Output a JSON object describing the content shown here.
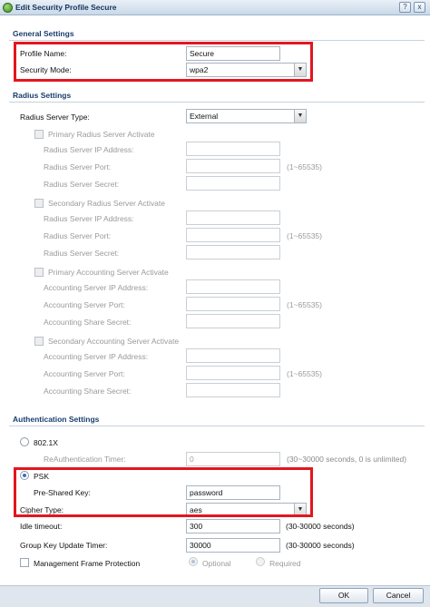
{
  "window": {
    "title": "Edit Security Profile Secure",
    "help_glyph": "?",
    "close_glyph": "x"
  },
  "general": {
    "section_title": "General Settings",
    "profile_name_label": "Profile Name:",
    "profile_name_value": "Secure",
    "security_mode_label": "Security Mode:",
    "security_mode_value": "wpa2"
  },
  "radius": {
    "section_title": "Radius Settings",
    "server_type_label": "Radius Server Type:",
    "server_type_value": "External",
    "groups": [
      {
        "check_label": "Primary Radius Server Activate",
        "ip_label": "Radius Server IP Address:",
        "port_label": "Radius Server Port:",
        "port_hint": "(1~65535)",
        "secret_label": "Radius Server Secret:"
      },
      {
        "check_label": "Secondary Radius Server Activate",
        "ip_label": "Radius Server IP Address:",
        "port_label": "Radius Server Port:",
        "port_hint": "(1~65535)",
        "secret_label": "Radius Server Secret:"
      },
      {
        "check_label": "Primary Accounting Server Activate",
        "ip_label": "Accounting Server IP Address:",
        "port_label": "Accounting Server Port:",
        "port_hint": "(1~65535)",
        "secret_label": "Accounting Share Secret:"
      },
      {
        "check_label": "Secondary Accounting Server Activate",
        "ip_label": "Accounting Server IP Address:",
        "port_label": "Accounting Server Port:",
        "port_hint": "(1~65535)",
        "secret_label": "Accounting Share Secret:"
      }
    ]
  },
  "auth": {
    "section_title": "Authentication Settings",
    "dot1x_label": "802.1X",
    "reauth_label": "ReAuthentication Timer:",
    "reauth_value": "0",
    "reauth_hint": "(30~30000 seconds, 0 is unlimited)",
    "psk_label": "PSK",
    "psk_key_label": "Pre-Shared Key:",
    "psk_key_value": "password",
    "cipher_label": "Cipher Type:",
    "cipher_value": "aes",
    "idle_label": "Idle timeout:",
    "idle_value": "300",
    "idle_hint": "(30-30000 seconds)",
    "gk_label": "Group Key Update Timer:",
    "gk_value": "30000",
    "gk_hint": "(30-30000 seconds)",
    "mfp_label": "Management Frame Protection",
    "mfp_optional": "Optional",
    "mfp_required": "Required"
  },
  "buttons": {
    "ok": "OK",
    "cancel": "Cancel"
  },
  "colors": {
    "highlight": "#e4151e",
    "section_title": "#1a3d6d"
  }
}
